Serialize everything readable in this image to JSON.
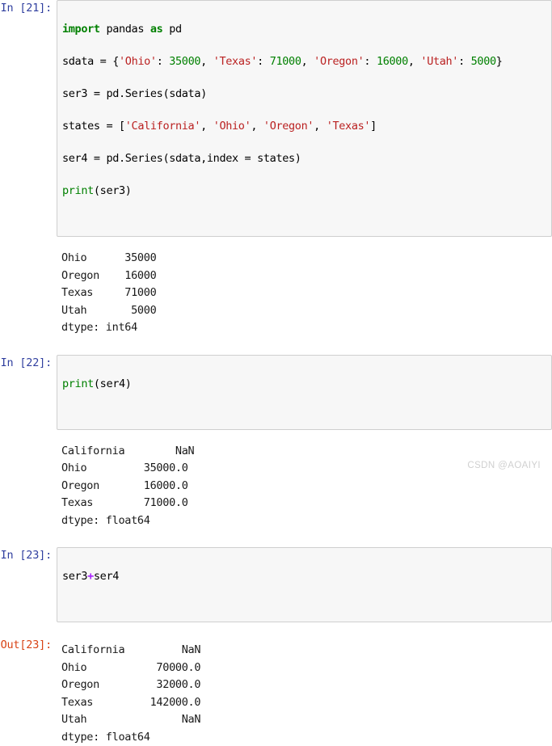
{
  "notebook": {
    "watermark": "CSDN @AOAIYI",
    "cells": [
      {
        "prompt_in": "In [21]:",
        "prompt_out": "",
        "code_lines": [
          "import pandas as pd",
          "sdata = {'Ohio': 35000, 'Texas': 71000, 'Oregon': 16000, 'Utah': 5000}",
          "ser3 = pd.Series(sdata)",
          "states = ['California', 'Ohio', 'Oregon', 'Texas']",
          "ser4 = pd.Series(sdata,index = states)",
          "print(ser3)"
        ],
        "output": "Ohio      35000\nOregon    16000\nTexas     71000\nUtah       5000\ndtype: int64"
      },
      {
        "prompt_in": "In [22]:",
        "prompt_out": "",
        "code_lines": [
          "print(ser4)"
        ],
        "output": "California        NaN\nOhio         35000.0\nOregon       16000.0\nTexas        71000.0\ndtype: float64"
      },
      {
        "prompt_in": "In [23]:",
        "prompt_out": "Out[23]:",
        "code_lines": [
          "ser3+ser4"
        ],
        "output": "California         NaN\nOhio           70000.0\nOregon         32000.0\nTexas         142000.0\nUtah               NaN\ndtype: float64"
      }
    ]
  },
  "colors": {
    "prompt_in": "#303f9f",
    "prompt_out": "#d84315",
    "keyword": "#008000",
    "string": "#ba2121",
    "number": "#008000",
    "operator": "#aa22ff",
    "cell_bg": "#f7f7f7",
    "cell_border": "#cfcfcf",
    "watermark": "#d0d0d0"
  }
}
